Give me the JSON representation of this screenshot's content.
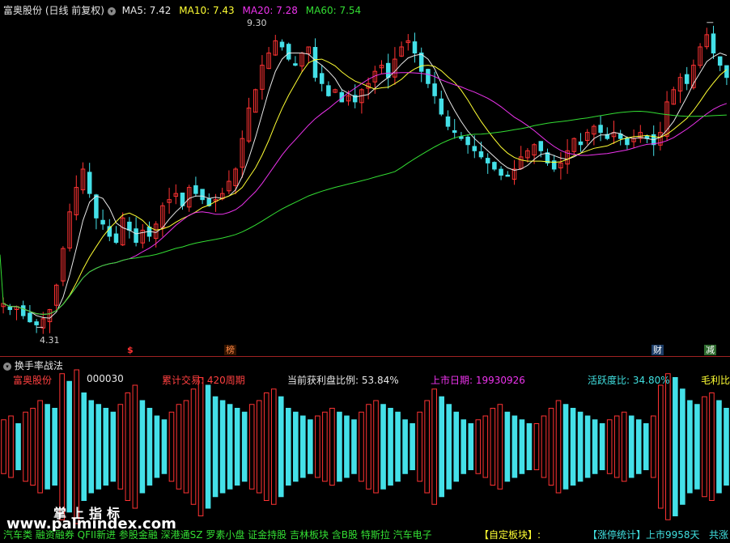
{
  "header": {
    "title": "富奥股份 (日线 前复权)",
    "ma5": "MA5: 7.42",
    "ma10": "MA10: 7.43",
    "ma20": "MA20: 7.28",
    "ma60": "MA60: 7.54"
  },
  "extremes": {
    "high": "9.30",
    "low": "4.31"
  },
  "markers": [
    "$",
    "榜",
    "财",
    "减"
  ],
  "indicator": {
    "title": "换手率战法",
    "stock_name": "富奥股份",
    "stock_code": "000030",
    "cumulative": "累计交易: 420周期",
    "profit_ratio": "当前获利盘比例: 53.84%",
    "listing_date": "上市日期: 19930926",
    "activity": "活跃度比: 34.80%",
    "gross_margin": "毛利比"
  },
  "watermark": {
    "cn": "掌上指标",
    "url": "www.palmindex.com"
  },
  "status": {
    "concepts": "汽车类 融资融券 QFII新进 参股金融 深港通SZ 罗素小盘 证金持股 吉林板块 含B股 特斯拉 汽车电子",
    "custom_sector": "【自定板块】:",
    "limit_stats": "【涨停统计】上市9958天",
    "total": "共涨"
  },
  "colors": {
    "up": "#ff3333",
    "down": "#44e0e8",
    "ma5": "#e8e8e8",
    "ma10": "#ffff33",
    "ma20": "#ee33ee",
    "ma60": "#33dd33"
  },
  "chart_data": {
    "type": "candlestick",
    "price_range": [
      4.31,
      9.3
    ],
    "ma5_last": 7.42,
    "ma10_last": 7.43,
    "ma20_last": 7.28,
    "ma60_last": 7.54,
    "close_path": [
      4.7,
      4.6,
      4.65,
      4.5,
      4.4,
      4.35,
      4.45,
      4.6,
      5.0,
      5.6,
      6.2,
      6.6,
      6.9,
      6.5,
      6.1,
      6.0,
      5.8,
      5.7,
      6.1,
      5.9,
      5.7,
      5.9,
      5.8,
      6.0,
      6.3,
      6.4,
      6.5,
      6.3,
      6.6,
      6.5,
      6.4,
      6.3,
      6.4,
      6.5,
      6.7,
      6.9,
      7.4,
      7.9,
      8.2,
      8.6,
      8.8,
      9.0,
      8.9,
      8.7,
      8.6,
      8.8,
      8.9,
      8.4,
      8.3,
      8.1,
      8.2,
      8.0,
      8.1,
      8.0,
      8.2,
      8.3,
      8.5,
      8.6,
      8.4,
      8.7,
      8.9,
      9.0,
      8.8,
      8.5,
      8.3,
      8.1,
      7.8,
      7.6,
      7.5,
      7.4,
      7.3,
      7.2,
      7.1,
      7.0,
      6.9,
      6.8,
      6.8,
      6.9,
      7.1,
      7.2,
      7.3,
      7.2,
      7.0,
      6.9,
      7.0,
      7.2,
      7.4,
      7.3,
      7.5,
      7.6,
      7.5,
      7.4,
      7.5,
      7.4,
      7.3,
      7.4,
      7.5,
      7.4,
      7.3,
      7.5,
      8.0,
      8.2,
      8.4,
      8.3,
      8.6,
      8.9,
      9.1,
      8.8,
      8.6,
      8.4
    ],
    "turnover_path": [
      0.35,
      0.4,
      0.3,
      0.45,
      0.5,
      0.6,
      0.55,
      0.5,
      0.95,
      0.85,
      1.0,
      0.7,
      0.6,
      0.55,
      0.5,
      0.45,
      0.55,
      0.7,
      0.8,
      0.6,
      0.5,
      0.4,
      0.35,
      0.45,
      0.55,
      0.6,
      0.75,
      0.9,
      0.8,
      0.65,
      0.6,
      0.55,
      0.5,
      0.45,
      0.55,
      0.6,
      0.7,
      0.75,
      0.65,
      0.5,
      0.45,
      0.4,
      0.35,
      0.4,
      0.45,
      0.5,
      0.45,
      0.4,
      0.35,
      0.45,
      0.55,
      0.6,
      0.55,
      0.5,
      0.45,
      0.35,
      0.3,
      0.45,
      0.6,
      0.75,
      0.65,
      0.55,
      0.45,
      0.35,
      0.3,
      0.35,
      0.4,
      0.5,
      0.55,
      0.45,
      0.4,
      0.35,
      0.3,
      0.3,
      0.4,
      0.5,
      0.6,
      0.55,
      0.5,
      0.45,
      0.4,
      0.35,
      0.3,
      0.35,
      0.4,
      0.45,
      0.4,
      0.35,
      0.3,
      0.4,
      0.8,
      0.95,
      0.9,
      0.75,
      0.6,
      0.55,
      0.65,
      0.7,
      0.6,
      0.5
    ]
  }
}
